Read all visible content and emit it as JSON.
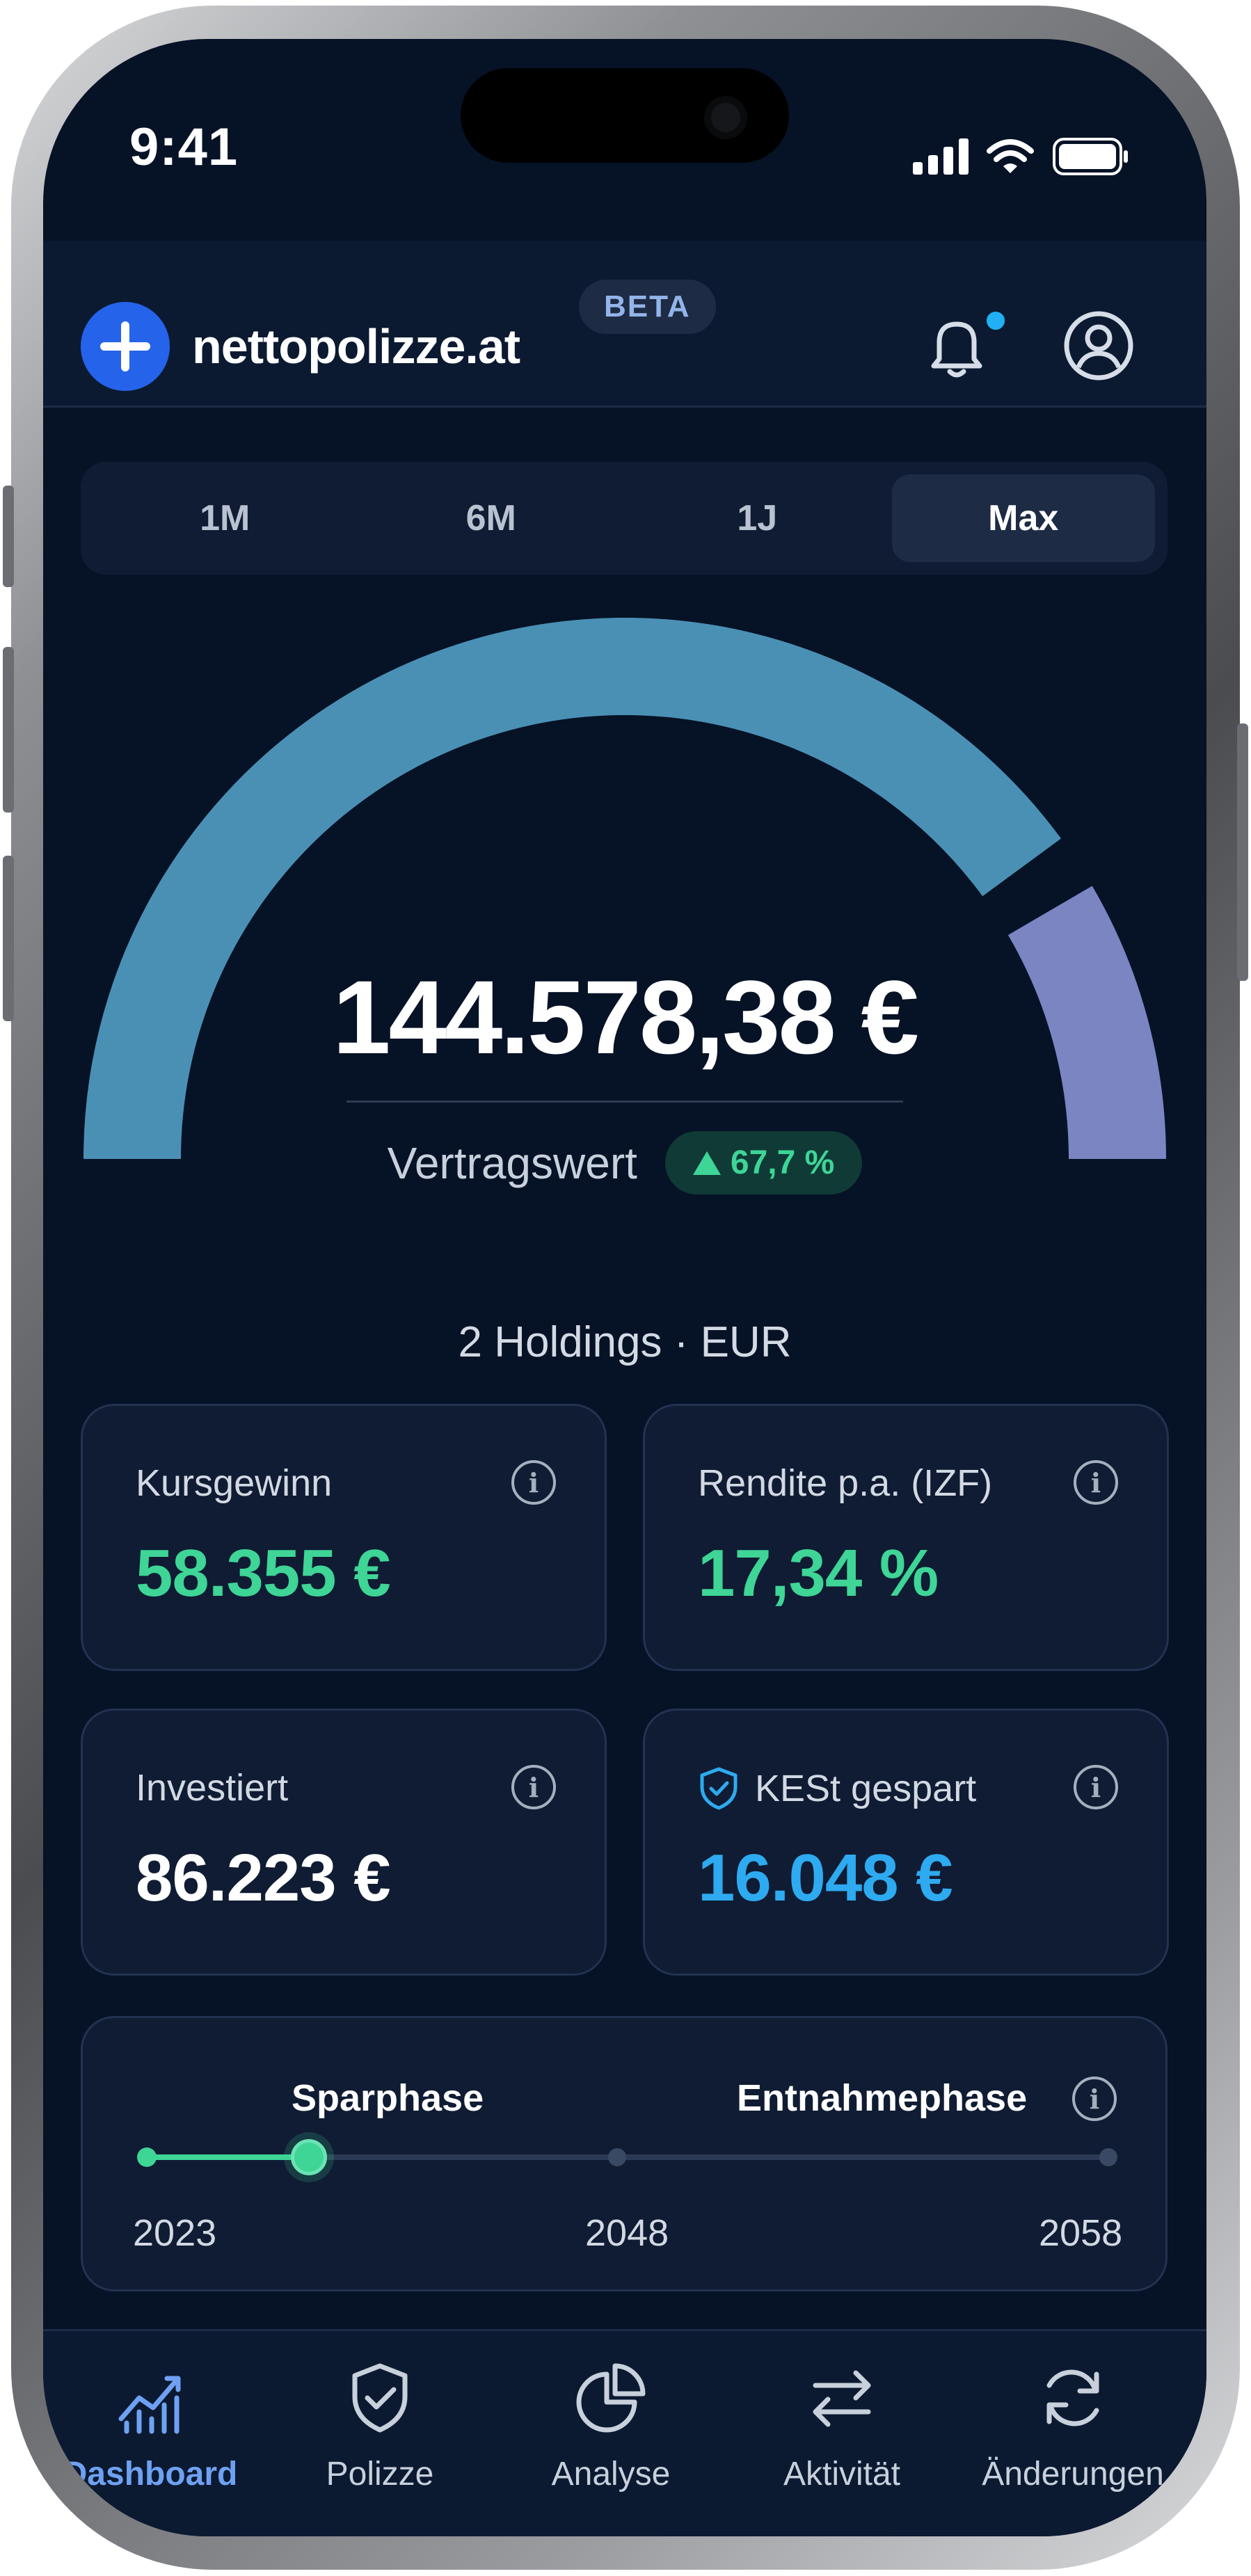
{
  "status_bar": {
    "time": "9:41"
  },
  "header": {
    "brand": "nettopolizze.at",
    "badge": "BETA",
    "notification_dot_color": "#22b0f5",
    "logo_color": "#2563eb"
  },
  "range_tabs": [
    {
      "label": "1M",
      "active": false
    },
    {
      "label": "6M",
      "active": false
    },
    {
      "label": "1J",
      "active": false
    },
    {
      "label": "Max",
      "active": true
    }
  ],
  "gauge": {
    "value": "144.578,38 €",
    "label": "Vertragswert",
    "change": "67,7 %",
    "change_direction": "up",
    "fraction": 0.815,
    "segment_colors": [
      "#4a90b4",
      "#7a85c2"
    ]
  },
  "holdings_summary": "2 Holdings · EUR",
  "stats": {
    "kursgewinn": {
      "label": "Kursgewinn",
      "value": "58.355 €"
    },
    "rendite": {
      "label": "Rendite p.a. (IZF)",
      "value": "17,34 %"
    },
    "investiert": {
      "label": "Investiert",
      "value": "86.223 €"
    },
    "kest": {
      "label": "KESt gespart",
      "value": "16.048 €"
    }
  },
  "phases": {
    "saving_label": "Sparphase",
    "withdrawal_label": "Entnahmephase",
    "years": [
      "2023",
      "2048",
      "2058"
    ],
    "progress_fraction": 0.17
  },
  "nav": [
    {
      "label": "Dashboard",
      "icon": "chart-bars-icon",
      "active": true
    },
    {
      "label": "Polizze",
      "icon": "shield-check-icon",
      "active": false
    },
    {
      "label": "Analyse",
      "icon": "pie-chart-icon",
      "active": false
    },
    {
      "label": "Aktivität",
      "icon": "arrows-swap-icon",
      "active": false
    },
    {
      "label": "Änderungen",
      "icon": "refresh-icon",
      "active": false
    }
  ],
  "colors": {
    "background": "#061226",
    "card": "#0f1c33",
    "positive": "#3ed597",
    "accent_blue": "#2eaaf0"
  }
}
